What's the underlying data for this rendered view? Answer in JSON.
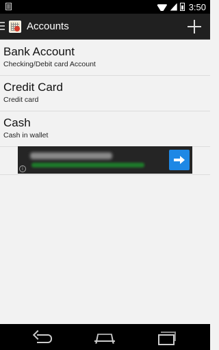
{
  "status_bar": {
    "time": "3:50",
    "icons": [
      "notification-icon",
      "wifi-icon",
      "signal-icon",
      "battery-icon"
    ]
  },
  "action_bar": {
    "title": "Accounts",
    "icons": [
      "drawer-icon",
      "app-icon",
      "add-icon"
    ]
  },
  "accounts": [
    {
      "name": "Bank Account",
      "description": "Checking/Debit card Account"
    },
    {
      "name": "Credit Card",
      "description": "Credit card"
    },
    {
      "name": "Cash",
      "description": "Cash in wallet"
    }
  ],
  "ad_banner": {
    "info_label": "i",
    "icons": [
      "info-icon",
      "arrow-right-icon"
    ],
    "colors": {
      "background": "#252525",
      "button": "#1e88e5"
    }
  },
  "nav_bar": {
    "icons": [
      "back-icon",
      "home-icon",
      "recent-apps-icon"
    ]
  },
  "colors": {
    "action_bar": "#202020",
    "list_background": "#f2f2f2"
  }
}
